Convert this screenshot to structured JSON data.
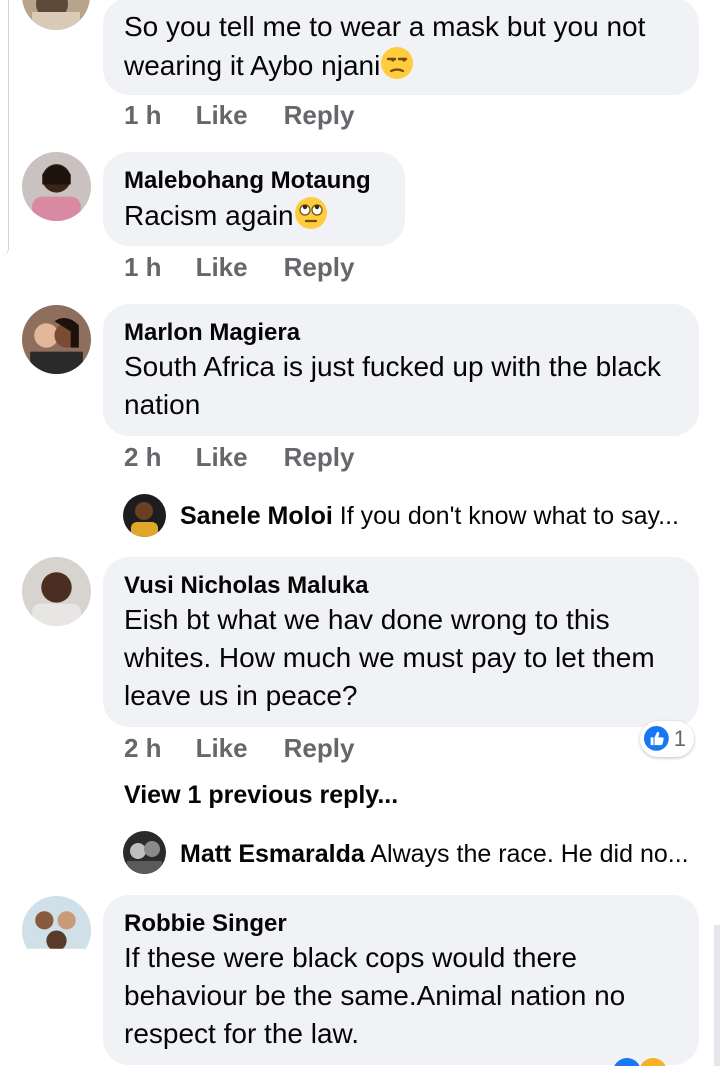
{
  "comments": [
    {
      "author": "",
      "text": "So you tell me to wear a mask but you not wearing it Aybo njani",
      "emoji": "unamused-face",
      "time": "1 h",
      "like_label": "Like",
      "reply_label": "Reply"
    },
    {
      "author": "Malebohang Motaung",
      "text": "Racism again",
      "emoji": "face-with-rolling-eyes",
      "time": "1 h",
      "like_label": "Like",
      "reply_label": "Reply"
    },
    {
      "author": "Marlon Magiera",
      "text": "South Africa is just fucked up with the black nation",
      "time": "2 h",
      "like_label": "Like",
      "reply_label": "Reply",
      "reply_preview": {
        "name": "Sanele Moloi",
        "text": "If you don't know what to say..."
      }
    },
    {
      "author": "Vusi Nicholas Maluka",
      "text": "Eish bt what we hav done wrong to this whites. How much we must pay to let them leave us in peace?",
      "time": "2 h",
      "like_label": "Like",
      "reply_label": "Reply",
      "reaction_count": "1",
      "view_more": "View 1 previous reply...",
      "reply_preview": {
        "name": "Matt Esmaralda",
        "text": "Always the race. He did no..."
      }
    },
    {
      "author": "Robbie Singer",
      "text": "If these were black cops would there behaviour be the same.Animal nation no respect for the law."
    }
  ],
  "colors": {
    "bubble": "#f0f2f5",
    "meta": "#65676b",
    "like_blue": "#1877f2",
    "haha_orange": "#f7b125"
  },
  "icons": [
    "like-reaction-icon",
    "unamused-face-emoji",
    "rolling-eyes-emoji"
  ]
}
